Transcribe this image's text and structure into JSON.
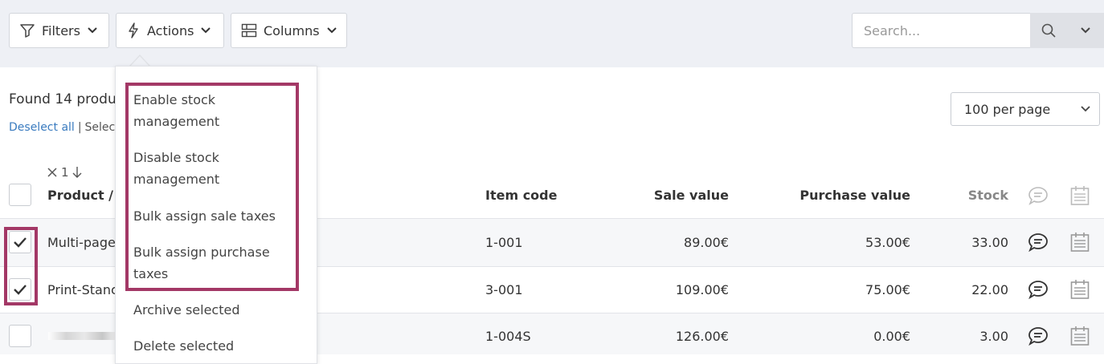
{
  "toolbar": {
    "filters_label": "Filters",
    "actions_label": "Actions",
    "columns_label": "Columns",
    "search_placeholder": "Search..."
  },
  "summary": {
    "found_text": "Found 14 produc",
    "deselect_all": "Deselect all",
    "separator": "|",
    "select_text": "Selec"
  },
  "per_page": {
    "value": "100 per page"
  },
  "sort_indicator": {
    "label": "1"
  },
  "table": {
    "headers": {
      "product": "Product / S",
      "item_code": "Item code",
      "sale_value": "Sale value",
      "purchase_value": "Purchase value",
      "stock": "Stock"
    },
    "rows": [
      {
        "checked": true,
        "product": "Multi-page",
        "item_code": "1-001",
        "sale_value": "89.00€",
        "purchase_value": "53.00€",
        "stock": "33.00"
      },
      {
        "checked": true,
        "product": "Print-Stanc",
        "item_code": "3-001",
        "sale_value": "109.00€",
        "purchase_value": "75.00€",
        "stock": "22.00"
      },
      {
        "checked": false,
        "product": "",
        "item_code": "1-004S",
        "sale_value": "126.00€",
        "purchase_value": "0.00€",
        "stock": "3.00"
      }
    ]
  },
  "actions_menu": {
    "items": [
      "Enable stock management",
      "Disable stock management",
      "Bulk assign sale taxes",
      "Bulk assign purchase taxes",
      "Archive selected",
      "Delete selected"
    ]
  },
  "colors": {
    "highlight": "#a33866",
    "link": "#3a7bbf",
    "toolbar_bg": "#eef0f5"
  }
}
